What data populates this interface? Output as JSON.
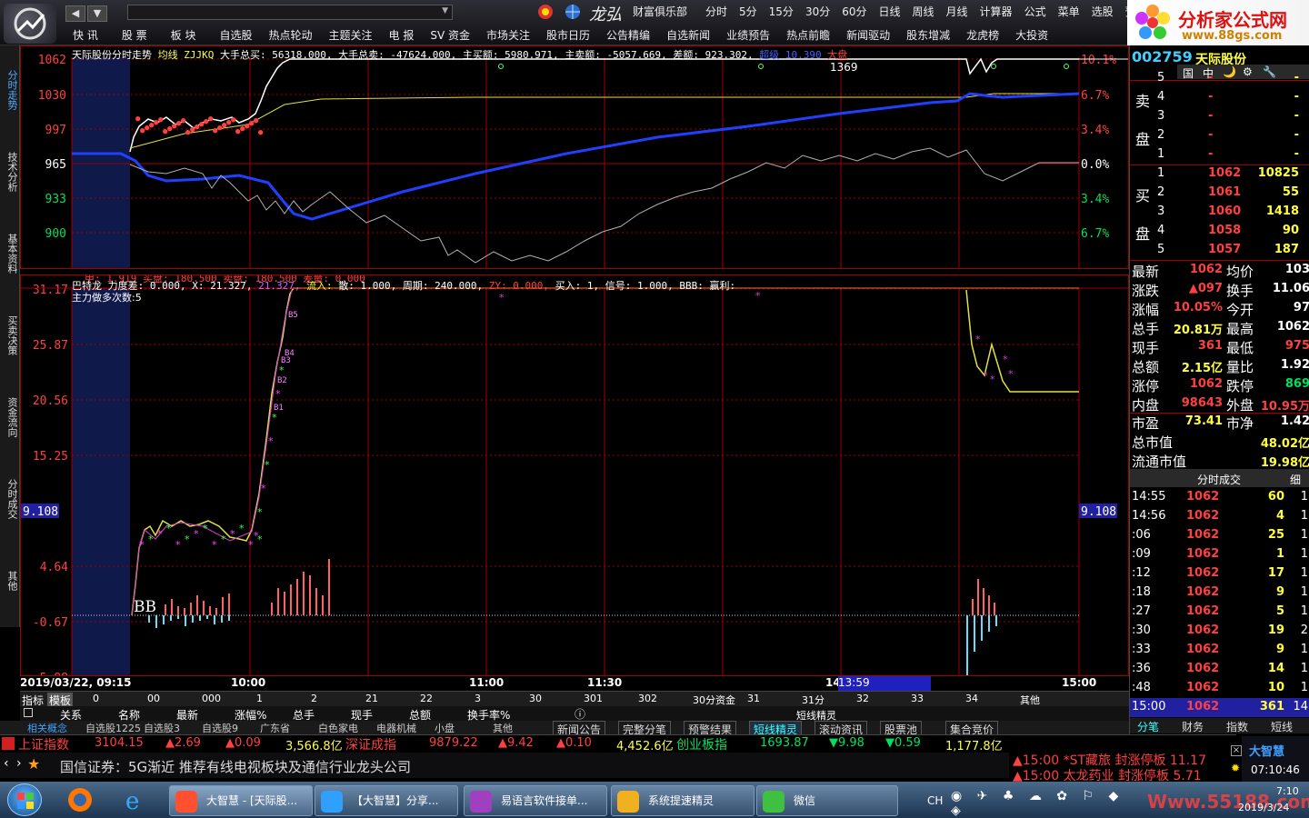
{
  "toolbar": {
    "nav_back": "◀",
    "nav_fwd": "▼",
    "brand_text": "财富俱乐部",
    "menu_row1": [
      "分时",
      "5分",
      "15分",
      "30分",
      "60分",
      "日线",
      "周线",
      "月线",
      "计算器",
      "公式",
      "菜单",
      "选股",
      "预警"
    ],
    "menu_row2": [
      "快 讯",
      "股 票",
      "板 块",
      "自选股",
      "热点轮动",
      "主题关注",
      "电 报",
      "SV 资金",
      "市场关注",
      "股市日历",
      "公告精编",
      "自选新闻",
      "业绩预告",
      "热点前瞻",
      "新闻驱动",
      "股东增减",
      "龙虎榜",
      "大投资"
    ],
    "ad_title": "分析家公式网",
    "ad_url": "www.88gs.com"
  },
  "left_tabs": [
    "分时走势",
    "技术分析",
    "基本资料",
    "买卖决策",
    "资金流向",
    "分时成交",
    "其他"
  ],
  "upper_chart": {
    "title": "天际股份分时走势",
    "avg_label": "均线",
    "code_label": "ZJJKQ",
    "big_buy": "大手总买: 56318.000,",
    "big_sell": "大手总卖: -47624.000,",
    "main_buy": "主买额: 5980.971,",
    "main_sell": "主卖额: -5057.669,",
    "diff": "差额: 923.302,",
    "extra": "超级 10.390",
    "dapan": "大盘",
    "mid_label": "1369",
    "y_left": [
      "1062",
      "1030",
      "997",
      "965",
      "933",
      "900"
    ],
    "y_right": [
      "10.1%",
      "6.7%",
      "3.4%",
      "0.0%",
      "3.4%",
      "6.7%"
    ]
  },
  "lower_chart": {
    "row1": "甲: 1.919  买盘: 180.500  卖盘: 180.500  差量: 0.000",
    "row2_a": "巴特龙 力度差: 0.000, X: 21.327,",
    "row2_b": "21.327,",
    "row2_c": "流入:",
    "row2_d": "散: 1.000, 周期: 240.000,",
    "row2_e": "ZY: 0.000,",
    "row2_f": "买入: 1, 信号: 1.000, BBB: 赢利:",
    "row3": "主力做多次数:5",
    "y_left": [
      "31.17",
      "25.87",
      "20.56",
      "15.25",
      "9.108",
      "4.64",
      "-0.67",
      "-5.98"
    ],
    "y_right": "9.108",
    "bb": "BB",
    "markers": [
      "B1",
      "B2",
      "B3",
      "B4",
      "B5"
    ],
    "volume_up": [
      12,
      18,
      10,
      8,
      14,
      22,
      16,
      10,
      8,
      20,
      24,
      14,
      30,
      26,
      34,
      40,
      48,
      44,
      30,
      22,
      62
    ],
    "volume_down": [
      8,
      14,
      10,
      6,
      4,
      12,
      8,
      6,
      4,
      10,
      8,
      6
    ],
    "volume_up2": [
      18,
      40,
      30,
      22,
      14
    ],
    "volume_down2": [
      66,
      40,
      28,
      18,
      12
    ]
  },
  "x_axis": [
    "2019/03/22, 09:15",
    "10:00",
    "11:00",
    "11:30",
    "14",
    "13:59",
    "15:00"
  ],
  "params": {
    "label1": "指标",
    "label2": "模板",
    "values": [
      "0",
      "00",
      "000",
      "1",
      "2",
      "21",
      "22",
      "3",
      "30",
      "301",
      "302",
      "30分资金",
      "31",
      "31分",
      "32",
      "33",
      "34",
      "其他"
    ]
  },
  "columns": [
    "关系",
    "名称",
    "最新",
    "涨幅%",
    "总手",
    "现手",
    "总额",
    "换手率%"
  ],
  "tabs_left": [
    "相关概念",
    "自选股1225",
    "自选股3",
    "自选股9",
    "广东省",
    "白色家电",
    "电器机械",
    "小盘",
    "其他"
  ],
  "tabs_right": [
    "新闻公告",
    "完整分笔",
    "预警结果",
    "短线精灵",
    "滚动资讯",
    "股票池",
    "集合竞价"
  ],
  "tab_header": "短线精灵",
  "right_panel": {
    "code": "002759",
    "name": "天际股份",
    "icons": [
      "国",
      "中",
      "🌙",
      "⚙",
      "🔧"
    ],
    "sell_label_1": "卖",
    "sell_label_2": "盘",
    "buy_label_1": "买",
    "buy_label_2": "盘",
    "sell_rows": [
      {
        "n": "5",
        "p": "-",
        "v": "-"
      },
      {
        "n": "4",
        "p": "-",
        "v": "-"
      },
      {
        "n": "3",
        "p": "-",
        "v": "-"
      },
      {
        "n": "2",
        "p": "-",
        "v": "-"
      },
      {
        "n": "1",
        "p": "-",
        "v": "-"
      }
    ],
    "buy_rows": [
      {
        "n": "1",
        "p": "1062",
        "v": "10825"
      },
      {
        "n": "2",
        "p": "1061",
        "v": "55"
      },
      {
        "n": "3",
        "p": "1060",
        "v": "1418"
      },
      {
        "n": "4",
        "p": "1058",
        "v": "90"
      },
      {
        "n": "5",
        "p": "1057",
        "v": "187"
      }
    ],
    "stats": [
      {
        "l1": "最新",
        "v1": "1062",
        "l2": "均价",
        "v2": "103"
      },
      {
        "l1": "涨跌",
        "v1": "▲097",
        "l2": "换手",
        "v2": "11.06"
      },
      {
        "l1": "涨幅",
        "v1": "10.05%",
        "l2": "今开",
        "v2": "97"
      },
      {
        "l1": "总手",
        "v1": "20.81万",
        "l2": "最高",
        "v2": "1062"
      },
      {
        "l1": "现手",
        "v1": "361",
        "l2": "最低",
        "v2": "975"
      },
      {
        "l1": "总额",
        "v1": "2.15亿",
        "l2": "量比",
        "v2": "1.92"
      },
      {
        "l1": "涨停",
        "v1": "1062",
        "l2": "跌停",
        "v2": "869"
      },
      {
        "l1": "内盘",
        "v1": "98643",
        "l2": "外盘",
        "v2": "10.95万"
      }
    ],
    "market": [
      {
        "l": "市盈",
        "v": "73.41",
        "l2": "市净",
        "v2": "1.42"
      },
      {
        "l": "总市值",
        "v": "48.02亿"
      },
      {
        "l": "流通市值",
        "v": "19.98亿"
      }
    ],
    "trades_header": "分时成交",
    "trades_btn": "细",
    "trades": [
      {
        "t": "14:55",
        "p": "1062",
        "v": "60",
        "c": "1"
      },
      {
        "t": "14:56",
        "p": "1062",
        "v": "4",
        "c": "1"
      },
      {
        "t": ":06",
        "p": "1062",
        "v": "25",
        "c": "1"
      },
      {
        "t": ":09",
        "p": "1062",
        "v": "1",
        "c": "1"
      },
      {
        "t": ":12",
        "p": "1062",
        "v": "17",
        "c": "1"
      },
      {
        "t": ":18",
        "p": "1062",
        "v": "9",
        "c": "1"
      },
      {
        "t": ":27",
        "p": "1062",
        "v": "5",
        "c": "1"
      },
      {
        "t": ":30",
        "p": "1062",
        "v": "19",
        "c": "2"
      },
      {
        "t": ":33",
        "p": "1062",
        "v": "9",
        "c": "1"
      },
      {
        "t": ":36",
        "p": "1062",
        "v": "14",
        "c": "1"
      },
      {
        "t": ":48",
        "p": "1062",
        "v": "10",
        "c": "1"
      },
      {
        "t": "15:00",
        "p": "1062",
        "v": "361",
        "c": "14"
      }
    ],
    "bottom_tabs": [
      "分笔",
      "财务",
      "指数",
      "短线"
    ]
  },
  "index_bar": {
    "sh_name": "上证指数",
    "sh_val": "3104.15",
    "sh_chg": "▲2.69",
    "sh_pct": "▲0.09",
    "sh_amt": "3,566.8亿",
    "sz_name": "深证成指",
    "sz_val": "9879.22",
    "sz_chg": "▲9.42",
    "sz_pct": "▲0.10",
    "sz_amt": "4,452.6亿",
    "cy_name": "创业板指",
    "cy_val": "1693.87",
    "cy_chg": "▼9.98",
    "cy_pct": "▼0.59",
    "cy_amt": "1,177.8亿"
  },
  "news": "国信证券：5G渐近 推荐有线电视板块及通信行业龙头公司",
  "alerts": [
    "▲15:00 *ST藏旅 封涨停板 11.17",
    "▲15:00 太龙药业 封涨停板 5.71"
  ],
  "clock": {
    "brand": "大智慧",
    "time": "07:10:46"
  },
  "taskbar": {
    "items": [
      "大智慧 - [天际股...",
      "【大智慧】分享...",
      "易语言软件接单...",
      "系统提速精灵",
      "微信"
    ],
    "tray_text": "CH",
    "clock_time": "7:10",
    "clock_date": "2019/3/24",
    "watermark": "Www.55188.com"
  }
}
